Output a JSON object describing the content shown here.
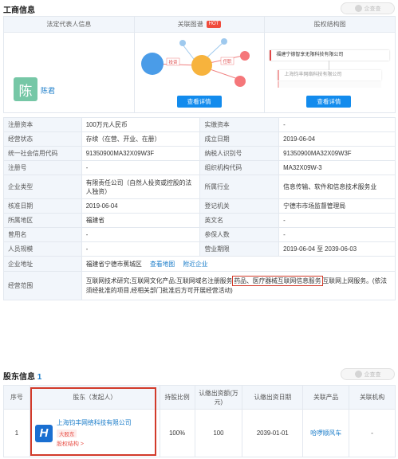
{
  "business_info": {
    "title": "工商信息",
    "watermark": "企查查",
    "cards": {
      "legal_rep": {
        "header": "法定代表人信息",
        "avatar_char": "陈",
        "name": "陈君"
      },
      "relation_graph": {
        "header": "关联图谱",
        "hot_badge": "HOT",
        "edge_labels": [
          "投资",
          "任职"
        ],
        "button": "查看详情"
      },
      "equity": {
        "header": "股权结构图",
        "top_company": "福建宁德智享无限科技有限公司",
        "sub_company": "上海钧丰网络科技有限公司",
        "button": "查看详情"
      }
    },
    "rows": [
      [
        "注册资本",
        "100万元人民币",
        "实缴资本",
        "-"
      ],
      [
        "经营状态",
        "存续（在营、开业、在册）",
        "成立日期",
        "2019-06-04"
      ],
      [
        "统一社会信用代码",
        "91350900MA32X09W3F",
        "纳税人识别号",
        "91350900MA32X09W3F"
      ],
      [
        "注册号",
        "-",
        "组织机构代码",
        "MA32X09W-3"
      ],
      [
        "企业类型",
        "有限责任公司（自然人投资或控股的法人独资）",
        "所属行业",
        "信息传输、软件和信息技术服务业"
      ],
      [
        "核准日期",
        "2019-06-04",
        "登记机关",
        "宁德市市场监督管理局"
      ],
      [
        "所属地区",
        "福建省",
        "英文名",
        "-"
      ],
      [
        "曾用名",
        "-",
        "参保人数",
        "-"
      ],
      [
        "人员规模",
        "-",
        "营业期限",
        "2019-06-04 至 2039-06-03"
      ]
    ],
    "address": {
      "label": "企业地址",
      "value": "福建省宁德市蕉城区",
      "map_link": "查看地图",
      "nearby_link": "附近企业"
    },
    "scope": {
      "label": "经营范围",
      "before": "互联网技术研究;互联网文化产品;互联网域名注册服务",
      "highlight": "药品、医疗器械互联网信息服务",
      "after": "互联网上网服务。(依法须经批准的项目,经相关部门批准后方可开展经营活动)"
    }
  },
  "shareholders": {
    "title": "股东信息",
    "count": "1",
    "watermark": "企查查",
    "headers": [
      "序号",
      "股东（发起人）",
      "持股比例",
      "认缴出资额(万元)",
      "认缴出资日期",
      "关联产品",
      "关联机构"
    ],
    "row": {
      "index": "1",
      "logo_char": "H",
      "name": "上海钧丰网络科技有限公司",
      "tag": "大股东",
      "structure_link": "股权结构 >",
      "ratio": "100%",
      "amount": "100",
      "date": "2039-01-01",
      "product": "哈啰顺风车",
      "org": "-"
    }
  }
}
